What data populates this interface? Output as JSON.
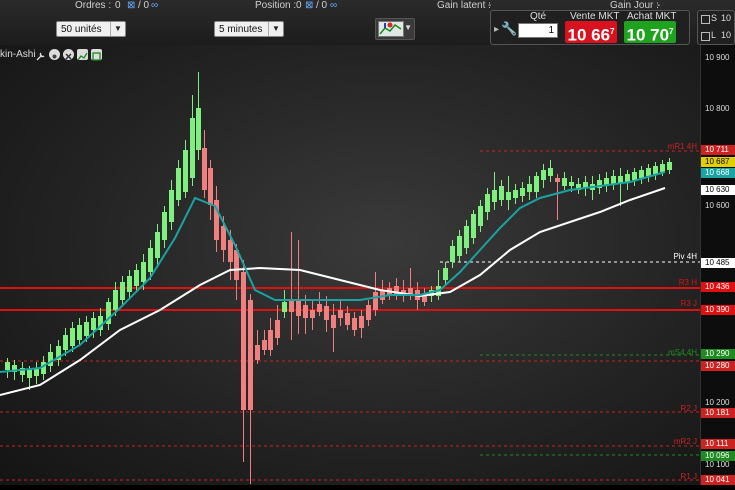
{
  "toolbar": {
    "orders_label": "Ordres :",
    "orders_value": "0",
    "orders_value2": "/ 0",
    "position_label": "Position :",
    "position_value": "0",
    "position_value2": "/ 0",
    "gain_latent_label": "Gain latent :",
    "gain_latent_value": "-",
    "gain_jour_label": "Gain Jour :",
    "gain_jour_value": "-",
    "units_select": "50 unités",
    "timeframe_select": "5 minutes"
  },
  "order_panel": {
    "qty_label": "Qté",
    "qty_value": "1",
    "sell_label": "Vente MKT",
    "sell_price": "10 66",
    "sell_price_sup": "7",
    "buy_label": "Achat MKT",
    "buy_price": "10 70",
    "buy_price_sup": "7",
    "sell_color": "#d8121f",
    "buy_color": "#1fa31f"
  },
  "right_panel": {
    "s_label": "S",
    "s_value": "10",
    "l_label": "L",
    "l_value": "10"
  },
  "chart_toolbar": {
    "indicator_name": "kin-Ashi",
    "icons": [
      "wrench-icon",
      "settings-icon",
      "close-icon",
      "chart-icon"
    ]
  },
  "price_axis": {
    "ticks": [
      "10 900",
      "10 800",
      "10 600",
      "10 200",
      "10 100"
    ],
    "tags": [
      {
        "text": "10 711",
        "color": "#cc2222"
      },
      {
        "text": "10 687",
        "color": "#e0d000"
      },
      {
        "text": "10 668",
        "color": "#1aa3a3"
      },
      {
        "text": "10 630",
        "color": "#ffffff"
      },
      {
        "text": "10 485",
        "color": "#ffffff"
      },
      {
        "text": "10 436",
        "color": "#dd1111"
      },
      {
        "text": "10 390",
        "color": "#dd1111"
      },
      {
        "text": "10 290",
        "color": "#1f8a1f"
      },
      {
        "text": "10 280",
        "color": "#cc2222"
      },
      {
        "text": "10 181",
        "color": "#cc2222"
      },
      {
        "text": "10 111",
        "color": "#cc2222"
      },
      {
        "text": "10 096",
        "color": "#1f8a1f"
      },
      {
        "text": "10 041",
        "color": "#cc2222"
      }
    ]
  },
  "level_labels": [
    {
      "text": "mR1 4H",
      "color": "#cc2222"
    },
    {
      "text": "Piv 4H",
      "color": "#ffffff"
    },
    {
      "text": "R3 H",
      "color": "#dd1111"
    },
    {
      "text": "R3 J",
      "color": "#dd1111"
    },
    {
      "text": "mS4 4H",
      "color": "#1f8a1f"
    },
    {
      "text": "R2 J",
      "color": "#cc2222"
    },
    {
      "text": "mR2 J",
      "color": "#cc2222"
    },
    {
      "text": "R1 J",
      "color": "#cc2222"
    }
  ],
  "colors": {
    "bull": "#7fef7f",
    "bear": "#f07f7f",
    "ma_fast": "#1aa3a3",
    "ma_slow": "#ffffff",
    "level_red": "#dd1111"
  }
}
